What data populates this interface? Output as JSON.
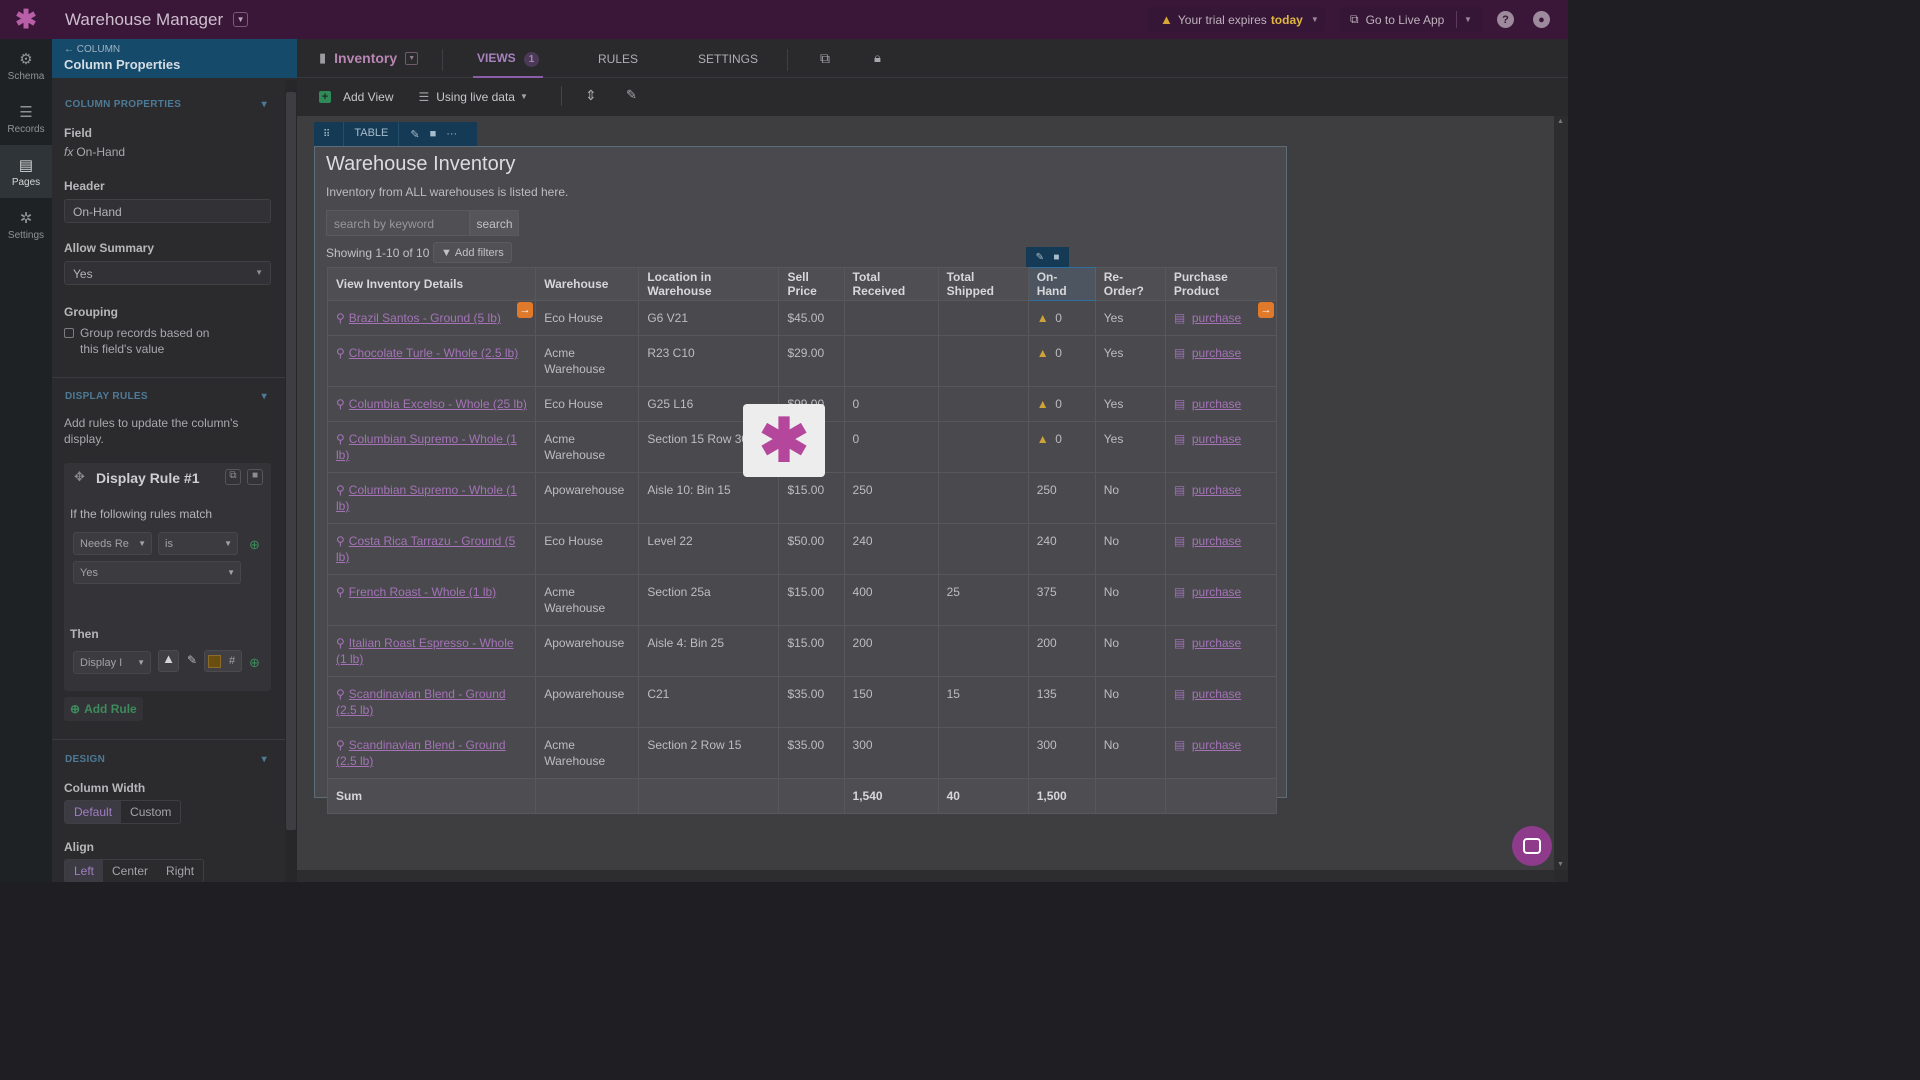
{
  "topbar": {
    "app_title": "Warehouse Manager",
    "trial_text": "Your trial expires",
    "trial_emph": "today",
    "go_live": "Go to Live App"
  },
  "rail": [
    {
      "label": "Schema",
      "icon": "schema-icon"
    },
    {
      "label": "Records",
      "icon": "database-icon"
    },
    {
      "label": "Pages",
      "icon": "pages-icon"
    },
    {
      "label": "Settings",
      "icon": "gear-icon"
    }
  ],
  "panel": {
    "back_label": "COLUMN",
    "title": "Column Properties",
    "section_props": "COLUMN PROPERTIES",
    "field_label": "Field",
    "field_value": "On-Hand",
    "header_label": "Header",
    "header_value": "On-Hand",
    "summary_label": "Allow Summary",
    "summary_value": "Yes",
    "grouping_label": "Grouping",
    "grouping_text": "Group records based on this field's value",
    "section_rules": "DISPLAY RULES",
    "rules_desc": "Add rules to update the column's display.",
    "rule_title": "Display Rule #1",
    "rule_if": "If the following rules match",
    "cond_field": "Needs Re",
    "cond_op": "is",
    "cond_value": "Yes",
    "then_label": "Then",
    "then_action": "Display I",
    "then_hex": "#",
    "add_rule": "Add Rule",
    "section_design": "DESIGN",
    "width_label": "Column Width",
    "width_default": "Default",
    "width_custom": "Custom",
    "align_label": "Align",
    "align_left": "Left",
    "align_center": "Center",
    "align_right": "Right"
  },
  "tabs": {
    "page_name": "Inventory",
    "views": "VIEWS",
    "views_count": "1",
    "rules": "RULES",
    "settings": "SETTINGS"
  },
  "toolbar": {
    "add_view": "Add View",
    "live_data": "Using live data"
  },
  "view": {
    "type_label": "TABLE",
    "title": "Warehouse Inventory",
    "description": "Inventory from ALL warehouses is listed here.",
    "search_placeholder": "search by keyword",
    "search_button": "search",
    "showing": "Showing 1-10 of 10",
    "add_filters": "Add filters",
    "columns": [
      "View Inventory Details",
      "Warehouse",
      "Location in Warehouse",
      "Sell Price",
      "Total Received",
      "Total Shipped",
      "On-Hand",
      "Re-Order?",
      "Purchase Product"
    ],
    "rows": [
      {
        "product": "Brazil Santos - Ground (5 lb)",
        "warehouse": "Eco House",
        "location": "G6 V21",
        "price": "$45.00",
        "received": "",
        "shipped": "",
        "onhand": "0",
        "warn": true,
        "reorder": "Yes",
        "purchase": "purchase"
      },
      {
        "product": "Chocolate Turle - Whole (2.5 lb)",
        "warehouse": "Acme Warehouse",
        "location": "R23 C10",
        "price": "$29.00",
        "received": "",
        "shipped": "",
        "onhand": "0",
        "warn": true,
        "reorder": "Yes",
        "purchase": "purchase"
      },
      {
        "product": "Columbia Excelso - Whole (25 lb)",
        "warehouse": "Eco House",
        "location": "G25 L16",
        "price": "$99.00",
        "received": "0",
        "shipped": "",
        "onhand": "0",
        "warn": true,
        "reorder": "Yes",
        "purchase": "purchase"
      },
      {
        "product": "Columbian Supremo - Whole (1 lb)",
        "warehouse": "Acme Warehouse",
        "location": "Section 15 Row 30",
        "price": "$25.00",
        "received": "0",
        "shipped": "",
        "onhand": "0",
        "warn": true,
        "reorder": "Yes",
        "purchase": "purchase"
      },
      {
        "product": "Columbian Supremo - Whole (1 lb)",
        "warehouse": "Apowarehouse",
        "location": "Aisle 10: Bin 15",
        "price": "$15.00",
        "received": "250",
        "shipped": "",
        "onhand": "250",
        "warn": false,
        "reorder": "No",
        "purchase": "purchase"
      },
      {
        "product": "Costa Rica Tarrazu - Ground (5 lb)",
        "warehouse": "Eco House",
        "location": "Level 22",
        "price": "$50.00",
        "received": "240",
        "shipped": "",
        "onhand": "240",
        "warn": false,
        "reorder": "No",
        "purchase": "purchase"
      },
      {
        "product": "French Roast - Whole (1 lb)",
        "warehouse": "Acme Warehouse",
        "location": "Section 25a",
        "price": "$15.00",
        "received": "400",
        "shipped": "25",
        "onhand": "375",
        "warn": false,
        "reorder": "No",
        "purchase": "purchase"
      },
      {
        "product": "Italian Roast Espresso - Whole (1 lb)",
        "warehouse": "Apowarehouse",
        "location": "Aisle 4: Bin 25",
        "price": "$15.00",
        "received": "200",
        "shipped": "",
        "onhand": "200",
        "warn": false,
        "reorder": "No",
        "purchase": "purchase"
      },
      {
        "product": "Scandinavian Blend - Ground (2.5 lb)",
        "warehouse": "Apowarehouse",
        "location": "C21",
        "price": "$35.00",
        "received": "150",
        "shipped": "15",
        "onhand": "135",
        "warn": false,
        "reorder": "No",
        "purchase": "purchase"
      },
      {
        "product": "Scandinavian Blend - Ground (2.5 lb)",
        "warehouse": "Acme Warehouse",
        "location": "Section 2 Row 15",
        "price": "$35.00",
        "received": "300",
        "shipped": "",
        "onhand": "300",
        "warn": false,
        "reorder": "No",
        "purchase": "purchase"
      }
    ],
    "sum_label": "Sum",
    "sum_received": "1,540",
    "sum_shipped": "40",
    "sum_onhand": "1,500"
  },
  "colors": {
    "brand": "#b4479c",
    "topbar": "#3a1739",
    "panel_header": "#164a6a",
    "link": "#a373b6",
    "warning": "#d0a338",
    "accent_orange": "#e07a2a"
  }
}
